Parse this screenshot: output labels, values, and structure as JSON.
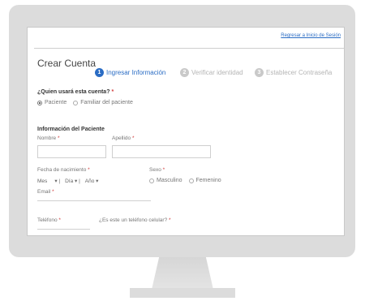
{
  "header": {
    "back_link": "Regresar a Inicio de Sesión"
  },
  "page": {
    "title": "Crear Cuenta"
  },
  "steps": [
    {
      "number": "1",
      "label": "Ingresar Información",
      "state": "active"
    },
    {
      "number": "2",
      "label": "Verificar identidad",
      "state": "inactive"
    },
    {
      "number": "3",
      "label": "Establecer Contraseña",
      "state": "inactive"
    }
  ],
  "who_question": {
    "label": "¿Quien usará esta cuenta?",
    "required_mark": "*",
    "options": [
      {
        "label": "Paciente",
        "checked": true
      },
      {
        "label": "Familiar del paciente",
        "checked": false
      }
    ]
  },
  "patient_info": {
    "title": "Información del Paciente",
    "first_name_label": "Nombre",
    "last_name_label": "Apellido",
    "birthdate_label": "Fecha de nacimiento",
    "birthdate": {
      "month": "Mes",
      "day": "Día",
      "year": "Año"
    },
    "sex_label": "Sexo",
    "sex_options": [
      {
        "label": "Masculino",
        "checked": false
      },
      {
        "label": "Femenino",
        "checked": false
      }
    ],
    "email_label": "Email",
    "phone_label": "Teléfono",
    "cell_question": "¿Es este un teléfono celular?",
    "required_mark": "*"
  },
  "colors": {
    "accent": "#2a6cc4",
    "required": "#d23b3b",
    "monitor": "#dcdcdc"
  }
}
